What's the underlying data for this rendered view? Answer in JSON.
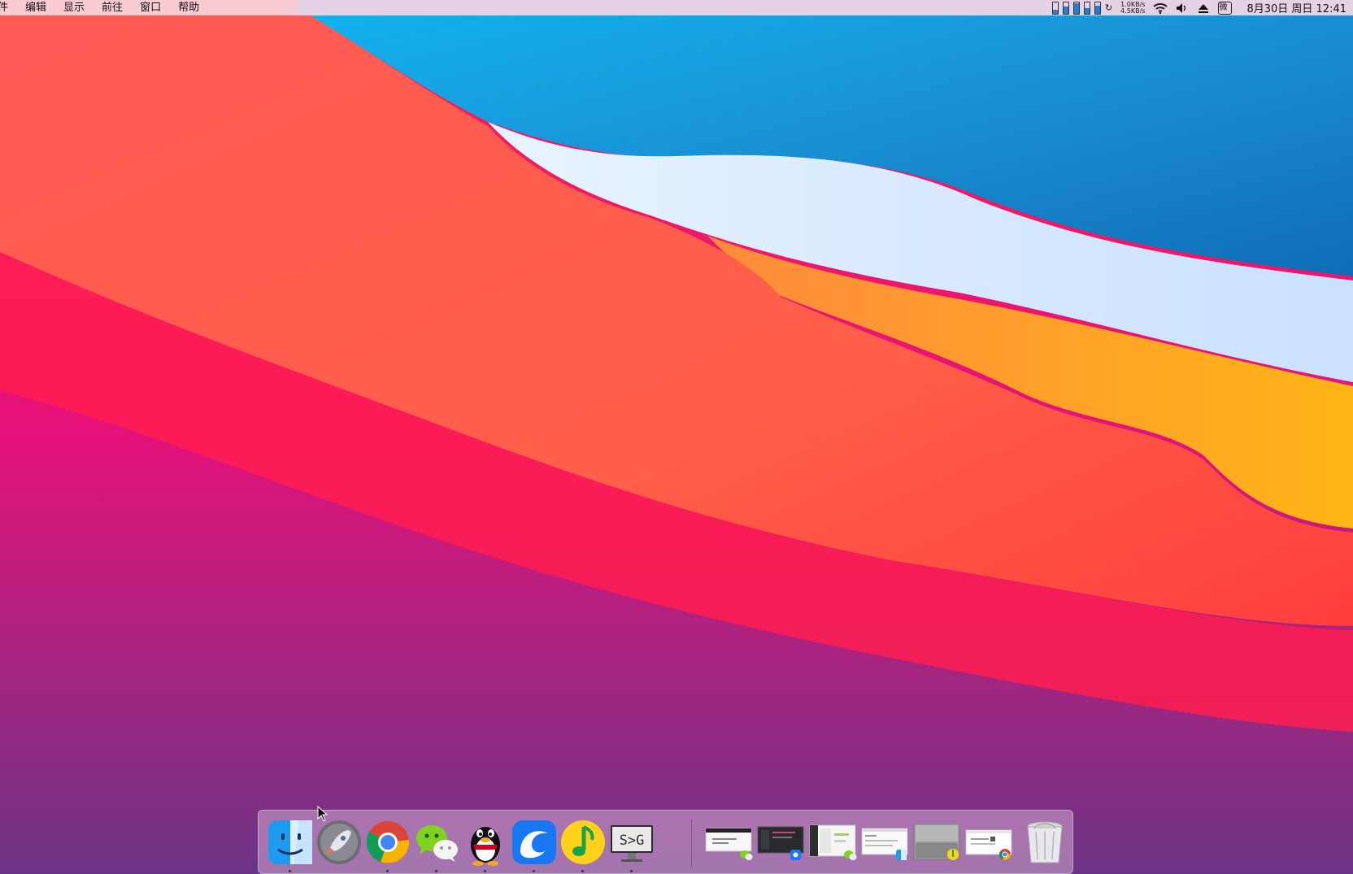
{
  "menubar": {
    "items": [
      "件",
      "编辑",
      "显示",
      "前往",
      "窗口",
      "帮助"
    ],
    "netspeed_up": "1.0KB/s",
    "netspeed_down": "4.5KB/s",
    "ime_label": "微",
    "clock": "8月30日 周日 12:41",
    "icons": [
      "battery-bars-icon",
      "wifi-icon",
      "volume-icon",
      "eject-icon",
      "ime-icon"
    ]
  },
  "dock": {
    "apps": [
      {
        "name": "finder",
        "icon": "finder-icon",
        "running": true
      },
      {
        "name": "launchpad",
        "icon": "rocket-icon",
        "running": false
      },
      {
        "name": "chrome",
        "icon": "chrome-icon",
        "running": true
      },
      {
        "name": "wechat",
        "icon": "wechat-icon",
        "running": true
      },
      {
        "name": "qq",
        "icon": "qq-penguin-icon",
        "running": true
      },
      {
        "name": "browser",
        "icon": "blue-wave-icon",
        "running": true
      },
      {
        "name": "qq-music",
        "icon": "music-note-icon",
        "running": true
      },
      {
        "name": "sg-app",
        "icon": "monitor-icon",
        "running": true
      }
    ],
    "sg_label": "S>G",
    "minimized_windows": [
      {
        "name": "window-wechat-1",
        "badge": "wechat-icon"
      },
      {
        "name": "window-browser",
        "badge": "blue-wave-icon"
      },
      {
        "name": "window-wechat-2",
        "badge": "wechat-icon"
      },
      {
        "name": "window-finder",
        "badge": "finder-icon"
      },
      {
        "name": "window-music",
        "badge": "music-note-icon"
      },
      {
        "name": "window-chrome",
        "badge": "chrome-icon"
      }
    ],
    "trash": {
      "icon": "trash-icon"
    }
  }
}
